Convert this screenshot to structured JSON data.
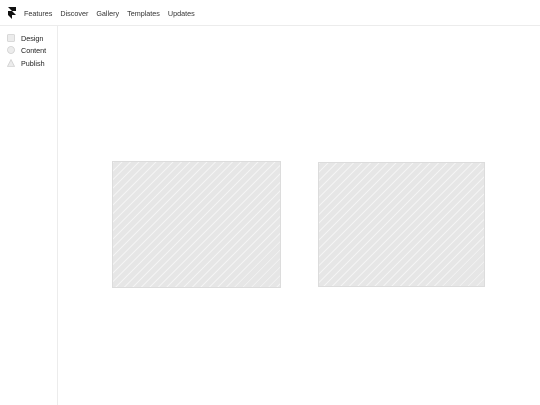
{
  "nav": {
    "items": [
      "Features",
      "Discover",
      "Gallery",
      "Templates",
      "Updates"
    ]
  },
  "sidebar": {
    "items": [
      {
        "label": "Design",
        "icon": "square-icon"
      },
      {
        "label": "Content",
        "icon": "circle-icon"
      },
      {
        "label": "Publish",
        "icon": "triangle-icon"
      }
    ]
  },
  "main": {
    "panels": [
      {
        "name": "image-placeholder-left"
      },
      {
        "name": "image-placeholder-right"
      }
    ]
  },
  "colors": {
    "panel": "#e6e6e6",
    "border": "#ececec",
    "icon": "#cfcfcf"
  }
}
